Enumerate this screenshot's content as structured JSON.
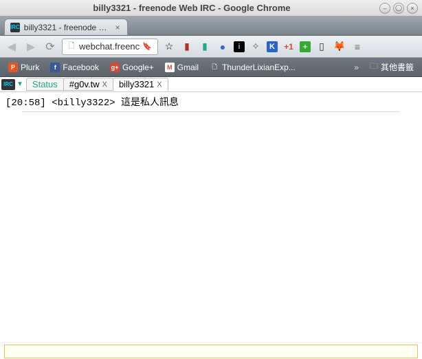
{
  "window": {
    "title": "billy3321 - freenode Web IRC - Google Chrome"
  },
  "browser_tab": {
    "title": "billy3321 - freenode We",
    "favicon_text": "IRC"
  },
  "url": "webchat.freenc",
  "bookmarks": {
    "items": [
      {
        "label": "Plurk",
        "bg": "#e25822",
        "letter": "P"
      },
      {
        "label": "Facebook",
        "bg": "#3b5998",
        "letter": "f"
      },
      {
        "label": "Google+",
        "bg": "#d34836",
        "letter": "g+"
      },
      {
        "label": "Gmail",
        "bg": "#fff",
        "letter": "M"
      },
      {
        "label": "ThunderLixianExp...",
        "bg": "",
        "letter": ""
      }
    ],
    "other_label": "其他書籤"
  },
  "irc": {
    "app_icon_text": "IRC",
    "tabs": [
      {
        "label": "Status",
        "closable": false,
        "kind": "status"
      },
      {
        "label": "#g0v.tw",
        "closable": true,
        "kind": "channel"
      },
      {
        "label": "billy3321",
        "closable": true,
        "kind": "pm",
        "active": true
      }
    ],
    "messages": [
      {
        "time": "[20:58]",
        "nick": "<billy3322>",
        "text": "這是私人訊息"
      }
    ],
    "input_value": ""
  }
}
